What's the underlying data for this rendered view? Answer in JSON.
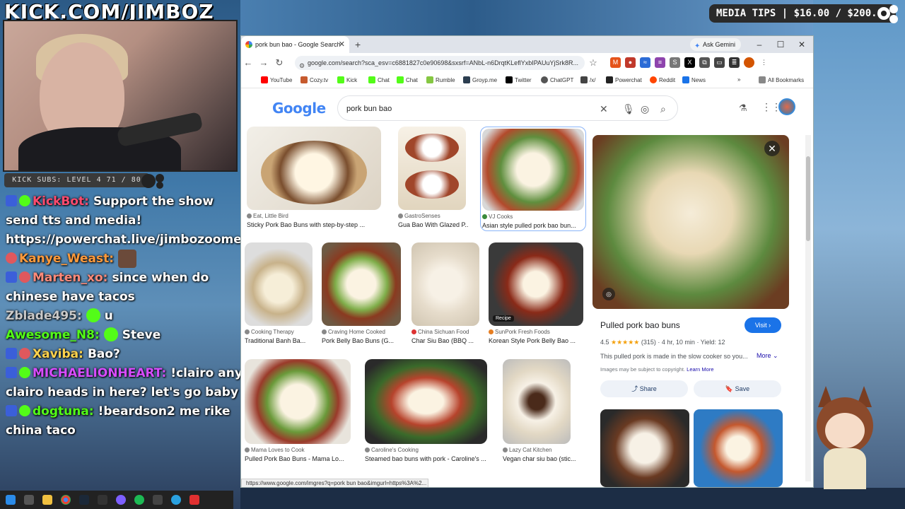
{
  "overlay": {
    "channel_name": "KICK.COM/JIMBOZ",
    "media_tips": "MEDIA TIPS | $16.00 / $200.00",
    "subs_bar": "KICK SUBS: LEVEL 4 71 / 80"
  },
  "chat": [
    {
      "user": "KickBot:",
      "color": "#ff4b6e",
      "text": "Support the show send tts and media!",
      "text2": "https://powerchat.live/jimbozoomer",
      "badges": [
        "kick",
        "verified"
      ]
    },
    {
      "user": "Kanye_Weast:",
      "color": "#ff9a3c",
      "text": "",
      "badges": [
        "sub"
      ],
      "emote": true
    },
    {
      "user": "Marten_xo:",
      "color": "#ff8a7a",
      "text": "since when do chinese have tacos",
      "badges": [
        "kick",
        "sub"
      ]
    },
    {
      "user": "Zblade495:",
      "color": "#c9c9c9",
      "text": "u",
      "badges": [],
      "emote_green": true
    },
    {
      "user": "Awesome_N8:",
      "color": "#53fc18",
      "text": "Steve",
      "badges": [],
      "emote_green": true
    },
    {
      "user": "Xaviba:",
      "color": "#ffd34d",
      "text": "Bao?",
      "badges": [
        "kick",
        "sub"
      ]
    },
    {
      "user": "MICHAELIONHEART:",
      "color": "#d84cff",
      "text": "!clairo any clairo heads in here? let's go baby",
      "badges": [
        "kick",
        "verified"
      ]
    },
    {
      "user": "dogtuna:",
      "color": "#53fc18",
      "text": "!beardson2 me rike china taco",
      "badges": [
        "kick",
        "verified"
      ]
    }
  ],
  "browser": {
    "tab_title": "pork bun bao - Google Search",
    "ask_gemini": "Ask Gemini",
    "url": "google.com/search?sca_esv=c6881827c0e90698&sxsrf=ANbL-n6DrqtKLeflYxbIPAUuYjSrk8R...",
    "bookmarks": [
      "YouTube",
      "Cozy.tv",
      "Kick",
      "Chat",
      "Chat",
      "Rumble",
      "Groyp.me",
      "Twitter",
      "ChatGPT",
      "/x/",
      "Powerchat",
      "Reddit",
      "News"
    ],
    "all_bookmarks": "All Bookmarks",
    "status_url": "https://www.google.com/imgres?q=pork bun bao&imgurl=https%3A%2..."
  },
  "search": {
    "logo": "Google",
    "query": "pork bun bao"
  },
  "results": [
    {
      "source": "Eat, Little Bird",
      "title": "Sticky Pork Bao Buns with step-by-step ..."
    },
    {
      "source": "GastroSenses",
      "title": "Gua Bao With Glazed P..."
    },
    {
      "source": "VJ Cooks",
      "title": "Asian style pulled pork bao bun..."
    },
    {
      "source": "Cooking Therapy",
      "title": "Traditional Banh Ba..."
    },
    {
      "source": "Craving Home Cooked",
      "title": "Pork Belly Bao Buns (G..."
    },
    {
      "source": "China Sichuan Food",
      "title": "Char Siu Bao (BBQ ..."
    },
    {
      "source": "SunPork Fresh Foods",
      "title": "Korean Style Pork Belly Bao ...",
      "tag": "Recipe"
    },
    {
      "source": "Mama Loves to Cook",
      "title": "Pulled Pork Bao Buns - Mama Lo..."
    },
    {
      "source": "Caroline's Cooking",
      "title": "Steamed bao buns with pork - Caroline's ..."
    },
    {
      "source": "Lazy Cat Kitchen",
      "title": "Vegan char siu bao (stic..."
    }
  ],
  "panel": {
    "title": "Pulled pork bao buns",
    "visit": "Visit",
    "rating": "4.5",
    "reviews": "(315)",
    "time": "4 hr, 10 min",
    "yield": "Yield: 12",
    "description": "This pulled pork is made in the slow cooker so you...",
    "more": "More",
    "copyright": "Images may be subject to copyright.",
    "learn_more": "Learn More",
    "share": "Share",
    "save": "Save"
  },
  "colors": {
    "accent_blue": "#1a73e8",
    "kick_green": "#53fc18"
  }
}
